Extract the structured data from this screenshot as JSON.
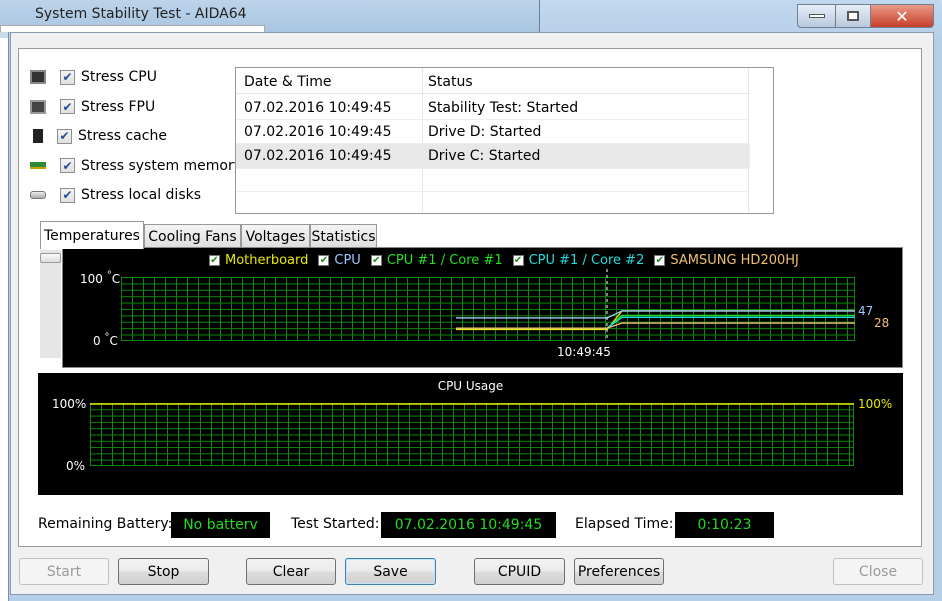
{
  "background_window": {
    "title": "System Stability Test - AIDA64"
  },
  "stress_options": [
    {
      "label": "Stress CPU",
      "checked": true,
      "icon": "cpu-icon"
    },
    {
      "label": "Stress FPU",
      "checked": true,
      "icon": "fpu-icon"
    },
    {
      "label": "Stress cache",
      "checked": true,
      "icon": "cache-icon"
    },
    {
      "label": "Stress system memory",
      "checked": true,
      "icon": "memory-icon"
    },
    {
      "label": "Stress local disks",
      "checked": true,
      "icon": "disk-icon"
    }
  ],
  "log": {
    "headers": [
      "Date & Time",
      "Status"
    ],
    "rows": [
      {
        "time": "07.02.2016 10:49:45",
        "status": "Stability Test: Started"
      },
      {
        "time": "07.02.2016 10:49:45",
        "status": "Drive D: Started"
      },
      {
        "time": "07.02.2016 10:49:45",
        "status": "Drive C: Started"
      }
    ]
  },
  "tabs": [
    "Temperatures",
    "Cooling Fans",
    "Voltages",
    "Statistics"
  ],
  "active_tab": "Temperatures",
  "chart_data": [
    {
      "type": "line",
      "title": "Temperatures",
      "ylabel_top": "100",
      "ylabel_bottom": "0",
      "unit": "°C",
      "ylim": [
        0,
        100
      ],
      "x_marker_label": "10:49:45",
      "series": [
        {
          "name": "Motherboard",
          "color": "#e8e800",
          "before": 18,
          "after": 47
        },
        {
          "name": "CPU",
          "color": "#9fc7ff",
          "before": 36,
          "after": 47
        },
        {
          "name": "CPU #1 / Core #1",
          "color": "#22e022",
          "before": 20,
          "after": 40
        },
        {
          "name": "CPU #1 / Core #2",
          "color": "#22dddd",
          "before": 20,
          "after": 37
        },
        {
          "name": "SAMSUNG HD200HJ",
          "color": "#f0c070",
          "before": 20,
          "after": 28
        }
      ],
      "current_labels": [
        {
          "text": "47",
          "color": "#9fc7ff"
        },
        {
          "text": "28",
          "color": "#f0c070"
        }
      ]
    },
    {
      "type": "line",
      "title": "CPU Usage",
      "ylabel_top": "100%",
      "ylabel_bottom": "0%",
      "ylim": [
        0,
        100
      ],
      "series": [
        {
          "name": "CPU Usage",
          "color": "#e8e800",
          "value": 100
        }
      ],
      "current_label": "100%"
    }
  ],
  "status": {
    "battery_label": "Remaining Battery:",
    "battery_value": "No batterv",
    "started_label": "Test Started:",
    "started_value": "07.02.2016 10:49:45",
    "elapsed_label": "Elapsed Time:",
    "elapsed_value": "0:10:23"
  },
  "buttons": {
    "start": "Start",
    "stop": "Stop",
    "clear": "Clear",
    "save": "Save",
    "cpuid": "CPUID",
    "preferences": "Preferences",
    "close": "Close"
  }
}
